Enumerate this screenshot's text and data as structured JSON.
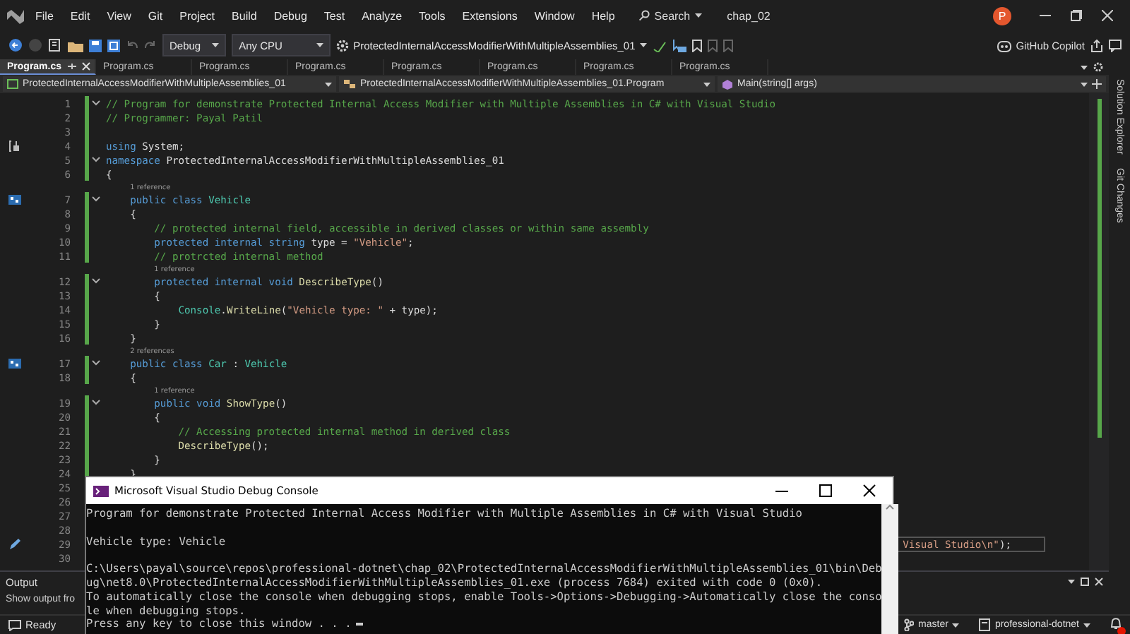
{
  "menu": {
    "items": [
      "File",
      "Edit",
      "View",
      "Git",
      "Project",
      "Build",
      "Debug",
      "Test",
      "Analyze",
      "Tools",
      "Extensions",
      "Window",
      "Help"
    ],
    "search": "Search",
    "solution_name": "chap_02",
    "avatar_initial": "P"
  },
  "toolbar": {
    "configuration": "Debug",
    "platform": "Any CPU",
    "startup_project": "ProtectedInternalAccessModifierWithMultipleAssemblies_01",
    "copilot": "GitHub Copilot"
  },
  "tabs": [
    {
      "label": "Program.cs",
      "selected": true
    },
    {
      "label": "Program.cs",
      "selected": false
    },
    {
      "label": "Program.cs",
      "selected": false
    },
    {
      "label": "Program.cs",
      "selected": false
    },
    {
      "label": "Program.cs",
      "selected": false
    },
    {
      "label": "Program.cs",
      "selected": false
    },
    {
      "label": "Program.cs",
      "selected": false
    },
    {
      "label": "Program.cs",
      "selected": false
    }
  ],
  "navigation_bar": {
    "project": "ProtectedInternalAccessModifierWithMultipleAssemblies_01",
    "type": "ProtectedInternalAccessModifierWithMultipleAssemblies_01.Program",
    "member": "Main(string[] args)"
  },
  "editor": {
    "lines": [
      {
        "number": "1",
        "expanded": true,
        "tokens": [
          {
            "text": "// Program for demonstrate Protected Internal Access Modifier with Multiple Assemblies in C# with Visual Studio",
            "kind": "comment"
          }
        ]
      },
      {
        "number": "2",
        "tokens": [
          {
            "text": "// Programmer: Payal Patil",
            "kind": "comment"
          }
        ]
      },
      {
        "number": "3"
      },
      {
        "number": "4",
        "gutter": {
          "kind": "scope"
        },
        "tokens": [
          {
            "text": "using",
            "kind": "keyword"
          },
          {
            "text": " System;",
            "kind": "plain"
          }
        ]
      },
      {
        "number": "5",
        "expanded": true,
        "tokens": [
          {
            "text": "namespace",
            "kind": "keyword"
          },
          {
            "text": " ProtectedInternalAccessModifierWithMultipleAssemblies_01",
            "kind": "plain"
          }
        ]
      },
      {
        "number": "6",
        "tokens": [
          {
            "text": "{",
            "kind": "plain"
          }
        ]
      },
      {
        "number": "7",
        "lens": "1 reference",
        "gutter": {
          "kind": "hierarchy"
        },
        "expanded": true,
        "tokens": [
          {
            "text": "    public class ",
            "kind": "keyword"
          },
          {
            "text": "Vehicle",
            "kind": "type"
          }
        ]
      },
      {
        "number": "8",
        "tokens": [
          {
            "text": "    {",
            "kind": "plain"
          }
        ]
      },
      {
        "number": "9",
        "tokens": [
          {
            "text": "        // protected internal field, accessible in derived classes or within same assembly",
            "kind": "comment"
          }
        ]
      },
      {
        "number": "10",
        "tokens": [
          {
            "text": "        protected internal string",
            "kind": "keyword"
          },
          {
            "text": " type = ",
            "kind": "plain"
          },
          {
            "text": "\"Vehicle\"",
            "kind": "string"
          },
          {
            "text": ";",
            "kind": "plain"
          }
        ]
      },
      {
        "number": "11",
        "tokens": [
          {
            "text": "        // protrcted internal method",
            "kind": "comment"
          }
        ]
      },
      {
        "number": "12",
        "lens": "1 reference",
        "expanded": true,
        "tokens": [
          {
            "text": "        protected internal void ",
            "kind": "keyword"
          },
          {
            "text": "DescribeType",
            "kind": "method"
          },
          {
            "text": "()",
            "kind": "plain"
          }
        ]
      },
      {
        "number": "13",
        "tokens": [
          {
            "text": "        {",
            "kind": "plain"
          }
        ]
      },
      {
        "number": "14",
        "tokens": [
          {
            "text": "            Console",
            "kind": "type"
          },
          {
            "text": ".",
            "kind": "plain"
          },
          {
            "text": "WriteLine",
            "kind": "method"
          },
          {
            "text": "(",
            "kind": "plain"
          },
          {
            "text": "\"Vehicle type: \"",
            "kind": "string"
          },
          {
            "text": " + type);",
            "kind": "plain"
          }
        ]
      },
      {
        "number": "15",
        "tokens": [
          {
            "text": "        }",
            "kind": "plain"
          }
        ]
      },
      {
        "number": "16",
        "tokens": [
          {
            "text": "    }",
            "kind": "plain"
          }
        ]
      },
      {
        "number": "17",
        "lens": "2 references",
        "gutter": {
          "kind": "hierarchy"
        },
        "expanded": true,
        "tokens": [
          {
            "text": "    public class ",
            "kind": "keyword"
          },
          {
            "text": "Car",
            "kind": "type"
          },
          {
            "text": " : ",
            "kind": "plain"
          },
          {
            "text": "Vehicle",
            "kind": "type"
          }
        ]
      },
      {
        "number": "18",
        "tokens": [
          {
            "text": "    {",
            "kind": "plain"
          }
        ]
      },
      {
        "number": "19",
        "lens": "1 reference",
        "expanded": true,
        "tokens": [
          {
            "text": "        public void ",
            "kind": "keyword"
          },
          {
            "text": "ShowType",
            "kind": "method"
          },
          {
            "text": "()",
            "kind": "plain"
          }
        ]
      },
      {
        "number": "20",
        "tokens": [
          {
            "text": "        {",
            "kind": "plain"
          }
        ]
      },
      {
        "number": "21",
        "tokens": [
          {
            "text": "            // Accessing protected internal method in derived class",
            "kind": "comment"
          }
        ]
      },
      {
        "number": "22",
        "tokens": [
          {
            "text": "            DescribeType",
            "kind": "method"
          },
          {
            "text": "();",
            "kind": "plain"
          }
        ]
      },
      {
        "number": "23",
        "tokens": [
          {
            "text": "        }",
            "kind": "plain"
          }
        ]
      },
      {
        "number": "24",
        "tokens": [
          {
            "text": "    }",
            "kind": "plain"
          }
        ]
      },
      {
        "number": "25"
      },
      {
        "number": "26"
      },
      {
        "number": "27"
      },
      {
        "number": "28"
      },
      {
        "number": "29",
        "gutter": {
          "kind": "edit"
        },
        "current": true,
        "tokens": [
          {
            "text": "Visual Studio\\n\"",
            "kind": "string"
          },
          {
            "text": ");",
            "kind": "plain"
          }
        ]
      },
      {
        "number": "30"
      }
    ]
  },
  "output_panel": {
    "title": "Output",
    "show_output_from": "Show output fro"
  },
  "side_tabs": [
    "Solution Explorer",
    "Git Changes"
  ],
  "status_bar": {
    "status": "Ready",
    "branch": "master",
    "repository": "professional-dotnet"
  },
  "debug_console": {
    "title": "Microsoft Visual Studio Debug Console",
    "blocks": [
      [
        "Program for demonstrate Protected Internal Access Modifier with Multiple Assemblies in C# with Visual Studio"
      ],
      [
        "Vehicle type: Vehicle"
      ],
      [
        "C:\\Users\\payal\\source\\repos\\professional-dotnet\\chap_02\\ProtectedInternalAccessModifierWithMultipleAssemblies_01\\bin\\Deb",
        "ug\\net8.0\\ProtectedInternalAccessModifierWithMultipleAssemblies_01.exe (process 7684) exited with code 0 (0x0).",
        "To automatically close the console when debugging stops, enable Tools->Options->Debugging->Automatically close the conso",
        "le when debugging stops.",
        "Press any key to close this window . . ."
      ]
    ]
  }
}
